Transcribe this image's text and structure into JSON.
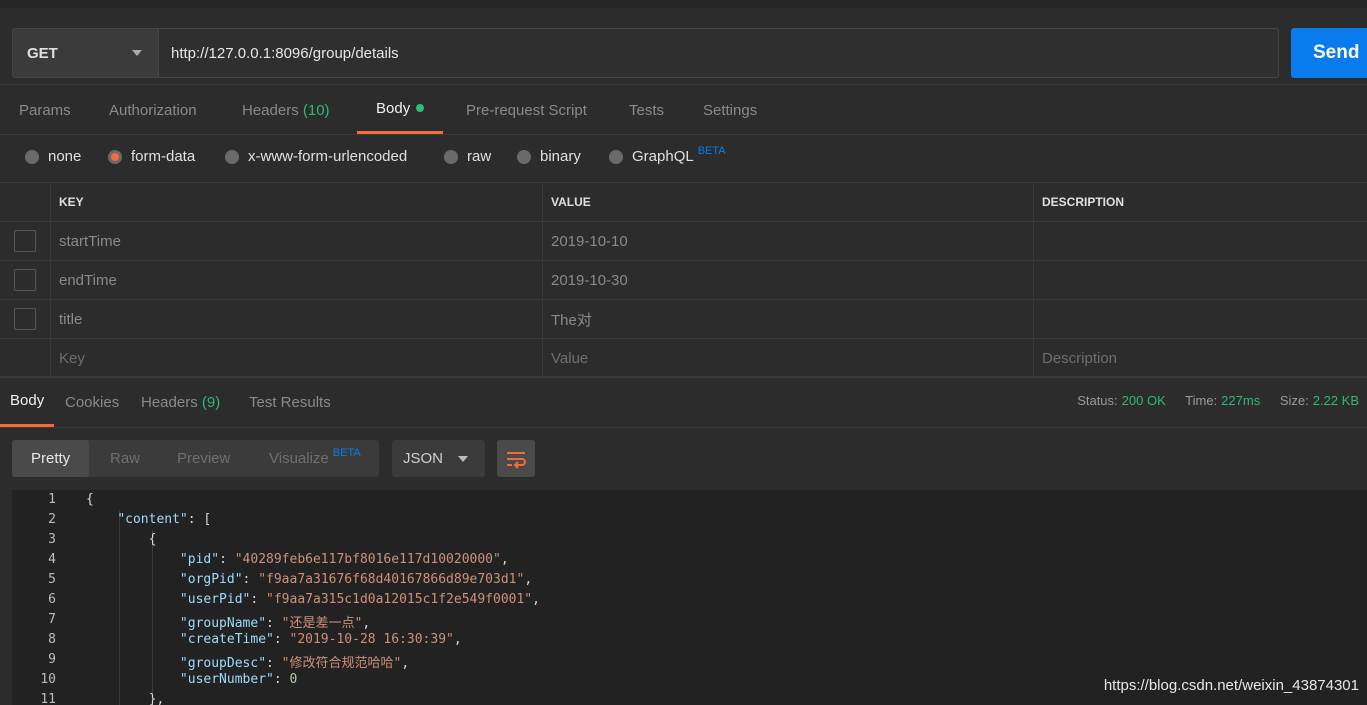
{
  "request": {
    "method": "GET",
    "url": "http://127.0.0.1:8096/group/details",
    "send_label": "Send"
  },
  "tabs": [
    {
      "label": "Params"
    },
    {
      "label": "Authorization"
    },
    {
      "label": "Headers",
      "count": "(10)"
    },
    {
      "label": "Body"
    },
    {
      "label": "Pre-request Script"
    },
    {
      "label": "Tests"
    },
    {
      "label": "Settings"
    }
  ],
  "body_types": [
    {
      "label": "none"
    },
    {
      "label": "form-data",
      "selected": true
    },
    {
      "label": "x-www-form-urlencoded"
    },
    {
      "label": "raw"
    },
    {
      "label": "binary"
    },
    {
      "label": "GraphQL",
      "badge": "BETA"
    }
  ],
  "kv_table": {
    "headers": [
      "KEY",
      "VALUE",
      "DESCRIPTION"
    ],
    "rows": [
      {
        "key": "startTime",
        "value": "2019-10-10",
        "description": ""
      },
      {
        "key": "endTime",
        "value": "2019-10-30",
        "description": ""
      },
      {
        "key": "title",
        "value": "The对",
        "description": ""
      }
    ],
    "placeholders": {
      "key": "Key",
      "value": "Value",
      "description": "Description"
    }
  },
  "response_tabs": [
    {
      "label": "Body"
    },
    {
      "label": "Cookies"
    },
    {
      "label": "Headers",
      "count": "(9)"
    },
    {
      "label": "Test Results"
    }
  ],
  "status": {
    "status_label": "Status:",
    "status_value": "200 OK",
    "time_label": "Time:",
    "time_value": "227ms",
    "size_label": "Size:",
    "size_value": "2.22 KB"
  },
  "view_modes": [
    "Pretty",
    "Raw",
    "Preview",
    "Visualize"
  ],
  "visualize_badge": "BETA",
  "format": "JSON",
  "code_lines": [
    {
      "n": "1",
      "text": "{"
    },
    {
      "n": "2",
      "text": "    \"content\": ["
    },
    {
      "n": "3",
      "text": "        {"
    },
    {
      "n": "4",
      "text": "            \"pid\": \"40289feb6e117bf8016e117d10020000\","
    },
    {
      "n": "5",
      "text": "            \"orgPid\": \"f9aa7a31676f68d40167866d89e703d1\","
    },
    {
      "n": "6",
      "text": "            \"userPid\": \"f9aa7a315c1d0a12015c1f2e549f0001\","
    },
    {
      "n": "7",
      "text": "            \"groupName\": \"还是差一点\","
    },
    {
      "n": "8",
      "text": "            \"createTime\": \"2019-10-28 16:30:39\","
    },
    {
      "n": "9",
      "text": "            \"groupDesc\": \"修改符合规范哈哈\","
    },
    {
      "n": "10",
      "text": "            \"userNumber\": 0"
    },
    {
      "n": "11",
      "text": "        },"
    }
  ],
  "watermark": "https://blog.csdn.net/weixin_43874301",
  "colors": {
    "accent": "#f26b3a",
    "send": "#097bed",
    "ok": "#2eba78"
  }
}
